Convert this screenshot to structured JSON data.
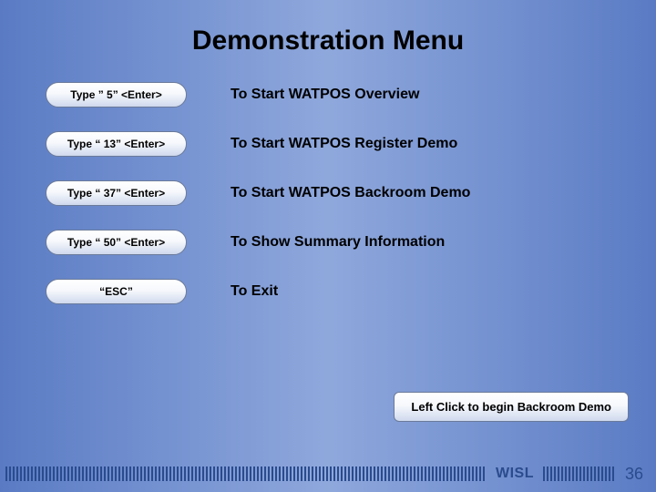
{
  "title": "Demonstration Menu",
  "menu": {
    "items": [
      {
        "key": "Type ” 5” <Enter>",
        "desc": "To Start WATPOS Overview"
      },
      {
        "key": "Type “ 13” <Enter>",
        "desc": "To Start WATPOS Register Demo"
      },
      {
        "key": "Type “ 37” <Enter>",
        "desc": "To Start WATPOS Backroom Demo"
      },
      {
        "key": "Type “ 50” <Enter>",
        "desc": "To Show Summary Information"
      },
      {
        "key": "“ESC”",
        "desc": "To Exit"
      }
    ]
  },
  "cta": {
    "label": "Left Click to begin Backroom Demo"
  },
  "footer": {
    "brand": "WISL",
    "page": "36"
  }
}
